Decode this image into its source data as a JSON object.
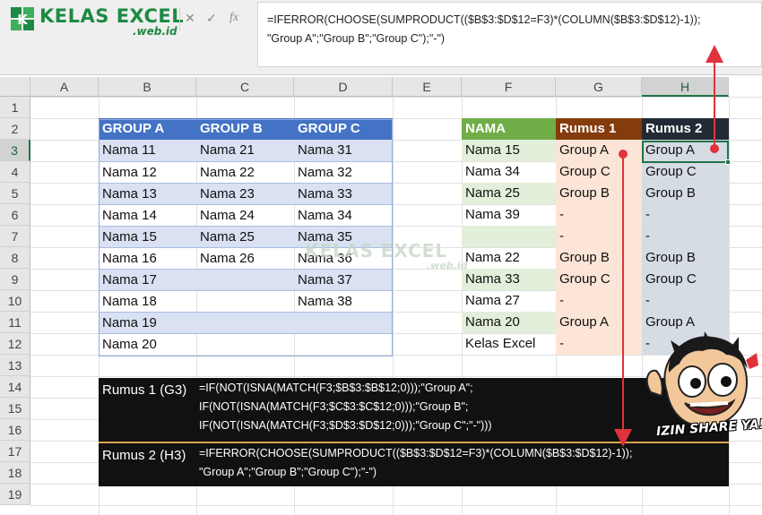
{
  "logo": {
    "title": "KELAS EXCEL",
    "subtitle": ".web.id",
    "brand_color": "#1d8a43"
  },
  "formula_bar": {
    "cancel_icon": "✕",
    "enter_icon": "✓",
    "fx_icon": "fx",
    "formula": "=IFERROR(CHOOSE(SUMPRODUCT(($B$3:$D$12=F3)*(COLUMN($B$3:$D$12)-1));\n\"Group A\";\"Group B\";\"Group C\");\"-\")"
  },
  "columns": [
    "A",
    "B",
    "C",
    "D",
    "E",
    "F",
    "G",
    "H"
  ],
  "rows": [
    "1",
    "2",
    "3",
    "4",
    "5",
    "6",
    "7",
    "8",
    "9",
    "10",
    "11",
    "12",
    "13",
    "14",
    "15",
    "16",
    "17",
    "18",
    "19"
  ],
  "group_table": {
    "headers": [
      "GROUP A",
      "GROUP B",
      "GROUP C"
    ],
    "rows": [
      [
        "Nama 11",
        "Nama 21",
        "Nama 31"
      ],
      [
        "Nama 12",
        "Nama 22",
        "Nama 32"
      ],
      [
        "Nama 13",
        "Nama 23",
        "Nama 33"
      ],
      [
        "Nama 14",
        "Nama 24",
        "Nama 34"
      ],
      [
        "Nama 15",
        "Nama 25",
        "Nama 35"
      ],
      [
        "Nama 16",
        "Nama 26",
        "Nama 36"
      ],
      [
        "Nama 17",
        "",
        "Nama 37"
      ],
      [
        "Nama 18",
        "",
        "Nama 38"
      ],
      [
        "Nama 19",
        "",
        ""
      ],
      [
        "Nama 20",
        "",
        ""
      ]
    ]
  },
  "lookup_table": {
    "headers": [
      "NAMA",
      "Rumus 1",
      "Rumus 2"
    ],
    "rows": [
      [
        "Nama 15",
        "Group A",
        "Group A"
      ],
      [
        "Nama 34",
        "Group C",
        "Group C"
      ],
      [
        "Nama 25",
        "Group B",
        "Group B"
      ],
      [
        "Nama 39",
        "-",
        "-"
      ],
      [
        "",
        "-",
        "-"
      ],
      [
        "Nama 22",
        "Group B",
        "Group B"
      ],
      [
        "Nama 33",
        "Group C",
        "Group C"
      ],
      [
        "Nama 27",
        "-",
        "-"
      ],
      [
        "Nama 20",
        "Group A",
        "Group A"
      ],
      [
        "Kelas Excel",
        "-",
        "-"
      ]
    ]
  },
  "rumus_panels": [
    {
      "label": "Rumus 1 (G3)",
      "formula": "=IF(NOT(ISNA(MATCH(F3;$B$3:$B$12;0)));\"Group A\";\nIF(NOT(ISNA(MATCH(F3;$C$3:$C$12;0)));\"Group B\";\nIF(NOT(ISNA(MATCH(F3;$D$3:$D$12;0)));\"Group C\";\"-\")))"
    },
    {
      "label": "Rumus 2 (H3)",
      "formula": "=IFERROR(CHOOSE(SUMPRODUCT(($B$3:$D$12=F3)*(COLUMN($B$3:$D$12)-1));\n\"Group A\";\"Group B\";\"Group C\");\"-\")"
    }
  ],
  "watermark": {
    "title": "KELAS EXCEL",
    "subtitle": ".web.id"
  },
  "mascot": {
    "caption": "IZIN SHARE YA!"
  },
  "selected_cell": "H3",
  "colors": {
    "blue_header": "#4472c4",
    "blue_light": "#d9e1f2",
    "green_header": "#70ad47",
    "green_light": "#e2efda",
    "brown_header": "#843c0c",
    "orange_light": "#fce4d6",
    "dark_header": "#222a35",
    "slate_light": "#d6dce4",
    "arrow_red": "#e0323c",
    "excel_green": "#217346"
  }
}
